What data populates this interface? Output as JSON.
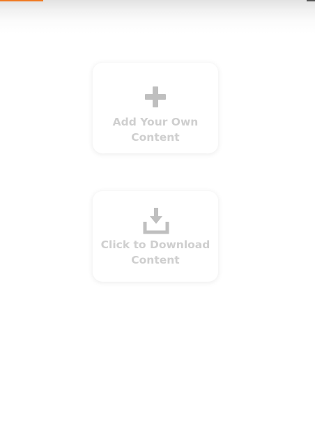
{
  "colors": {
    "accent": "#f07a22",
    "card_text": "#cfcfcf",
    "icon": "#bfbfbf"
  },
  "cards": [
    {
      "icon": "plus-icon",
      "label_line1": "Add Your Own",
      "label_line2": "Content"
    },
    {
      "icon": "download-icon",
      "label_line1": "Click to Download",
      "label_line2": "Content"
    }
  ]
}
